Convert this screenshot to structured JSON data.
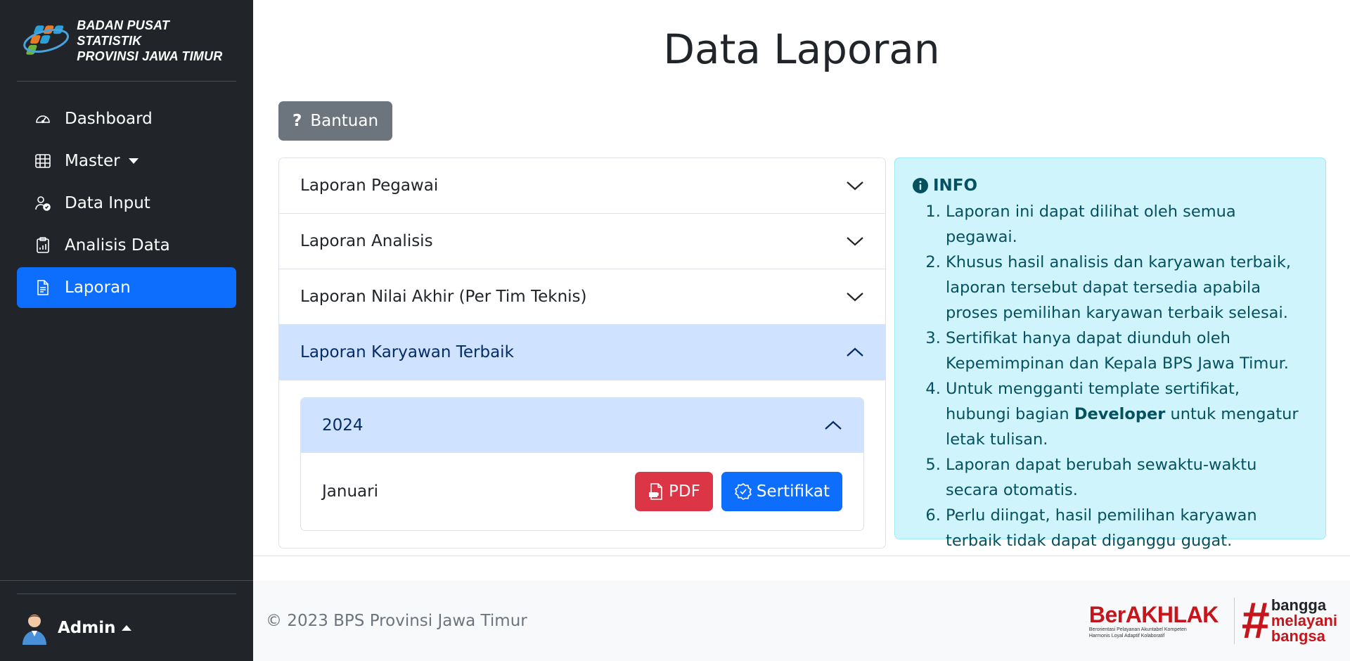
{
  "sidebar": {
    "brand": {
      "line1": "BADAN PUSAT STATISTIK",
      "line2": "PROVINSI JAWA TIMUR"
    },
    "items": [
      {
        "label": "Dashboard",
        "icon": "speedometer-icon"
      },
      {
        "label": "Master",
        "icon": "table-icon"
      },
      {
        "label": "Data Input",
        "icon": "person-check-icon"
      },
      {
        "label": "Analisis Data",
        "icon": "clipboard-chart-icon"
      },
      {
        "label": "Laporan",
        "icon": "file-text-icon",
        "active": true
      }
    ],
    "user": {
      "name": "Admin"
    }
  },
  "page": {
    "title": "Data Laporan"
  },
  "help_button": {
    "icon": "?",
    "label": "Bantuan"
  },
  "accordion": {
    "sections": [
      {
        "label": "Laporan Pegawai",
        "open": false
      },
      {
        "label": "Laporan Analisis",
        "open": false
      },
      {
        "label": "Laporan Nilai Akhir (Per Tim Teknis)",
        "open": false
      },
      {
        "label": "Laporan Karyawan Terbaik",
        "open": true
      }
    ],
    "inner": {
      "year": "2024",
      "month": "Januari",
      "pdf_label": "PDF",
      "cert_label": "Sertifikat"
    }
  },
  "info": {
    "title": "INFO",
    "items": [
      "Laporan ini dapat dilihat oleh semua pegawai.",
      "Khusus hasil analisis dan karyawan terbaik, laporan tersebut dapat tersedia apabila proses pemilihan karyawan terbaik selesai.",
      "Sertifikat hanya dapat diunduh oleh Kepemimpinan dan Kepala BPS Jawa Timur.",
      {
        "before": "Untuk mengganti template sertifikat, hubungi bagian ",
        "bold": "Developer",
        "after": " untuk mengatur letak tulisan."
      },
      "Laporan dapat berubah sewaktu-waktu secara otomatis.",
      "Perlu diingat, hasil pemilihan karyawan terbaik tidak dapat diganggu gugat."
    ]
  },
  "footer": {
    "copyright": "© 2023 BPS Provinsi Jawa Timur",
    "berakhlak": {
      "word": "BerAKHLAK",
      "line1": "Berorientasi Pelayanan Akuntabel Kompeten",
      "line2": "Harmonis Loyal Adaptif Kolaboratif"
    },
    "bangga": {
      "hash": "#",
      "l1": "bangga",
      "l2": "melayani",
      "l3": "bangsa"
    }
  },
  "colors": {
    "sidebar": "#212529",
    "primary": "#0d6efd",
    "danger": "#dc3545",
    "info_bg": "#cff4fc",
    "accordion_open": "#cfe2ff",
    "brand_red": "#c4161c"
  }
}
